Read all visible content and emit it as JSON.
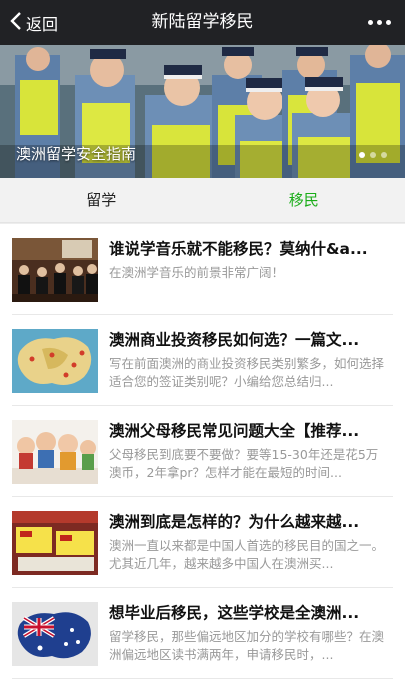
{
  "header": {
    "back_label": "返回",
    "title": "新陆留学移民"
  },
  "banner": {
    "caption": "澳洲留学安全指南",
    "slide_count": 3,
    "active_slide": 1
  },
  "tabs": [
    {
      "label": "留学",
      "active": false
    },
    {
      "label": "移民",
      "active": true
    }
  ],
  "articles": [
    {
      "title": "谁说学音乐就不能移民？莫纳什&a...",
      "summary": "在澳洲学音乐的前景非常广阔！",
      "thumb": "orchestra-photo"
    },
    {
      "title": "澳洲商业投资移民如何选？一篇文...",
      "summary": "写在前面澳洲的商业投资移民类别繁多，如何选择适合您的签证类别呢？小编给您总结归...",
      "thumb": "australia-map-photo"
    },
    {
      "title": "澳洲父母移民常见问题大全【推荐...",
      "summary": "父母移民到底要不要做？要等15-30年还是花5万澳币，2年拿pr？怎样才能在最短的时间...",
      "thumb": "figurines-photo"
    },
    {
      "title": "澳洲到底是怎样的？为什么越来越...",
      "summary": "澳洲一直以来都是中国人首选的移民目的国之一。尤其近几年，越来越多中国人在澳洲买...",
      "thumb": "supermarket-sale-photo"
    },
    {
      "title": "想毕业后移民，这些学校是全澳洲...",
      "summary": "留学移民，那些偏远地区加分的学校有哪些？在澳洲偏远地区读书满两年，申请移民时，...",
      "thumb": "australia-flag-map-photo"
    }
  ],
  "colors": {
    "topbar": "#212225",
    "accent": "#1aad19",
    "summary_text": "#999999"
  }
}
